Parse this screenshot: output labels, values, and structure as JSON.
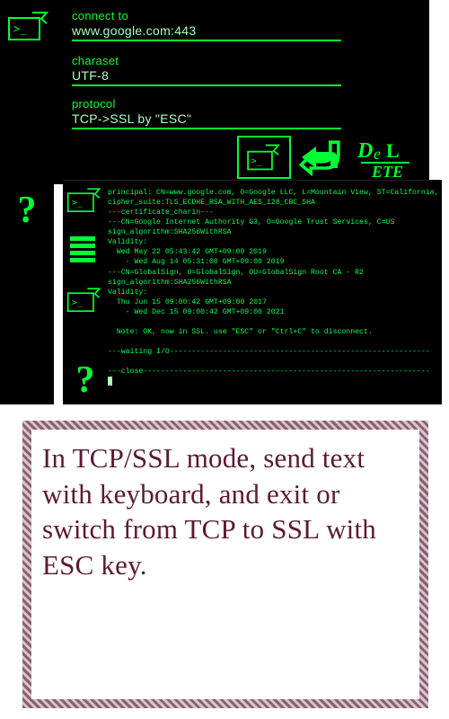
{
  "panel1": {
    "fields": {
      "connect": {
        "label": "connect to",
        "value": "www.google.com:443"
      },
      "charset": {
        "label": "charaset",
        "value": "UTF-8"
      },
      "protocol": {
        "label": "protocol",
        "value": "TCP->SSL by \"ESC\""
      }
    }
  },
  "toolbar": {
    "term_label": "terminal-icon",
    "back_label": "back-icon",
    "delete_label": "DeL\nETE"
  },
  "terminal": {
    "lines": [
      "principal: CN=www.google.com, O=Google LLC, L=Mountain View, ST=California, C=US",
      "cipher_suite:TLS_ECDHE_RSA_WITH_AES_128_CBC_SHA",
      "---certificate_charin---",
      "---CN=Google Internet Authority G3, O=Google Trust Services, C=US",
      "sign_algorithm:SHA256WithRSA",
      "Validity:",
      "  Wed May 22 05:43:42 GMT+09:00 2019",
      "    - Wed Aug 14 05:31:00 GMT+09:00 2019",
      "---CN=GlobalSign, O=GlobalSign, OU=GlobalSign Root CA - R2",
      "sign_algorithm:SHA256WithRSA",
      "Validity:",
      "  Thu Jun 15 09:00:42 GMT+09:00 2017",
      "    - Wed Dec 15 09:00:42 GMT+09:00 2021",
      "",
      "  Note: OK, now in SSL. use \"ESC\" or \"Ctrl+C\" to disconnect.",
      "",
      "---waiting I/O-----------------------------------------------------------",
      "",
      "---close-----------------------------------------------------------------"
    ]
  },
  "note": {
    "text": "In TCP/SSL mode, send text with keyboard, and exit or switch from TCP to SSL with ESC key."
  },
  "colors": {
    "green": "#00ff33",
    "text": "#5b1a33"
  }
}
